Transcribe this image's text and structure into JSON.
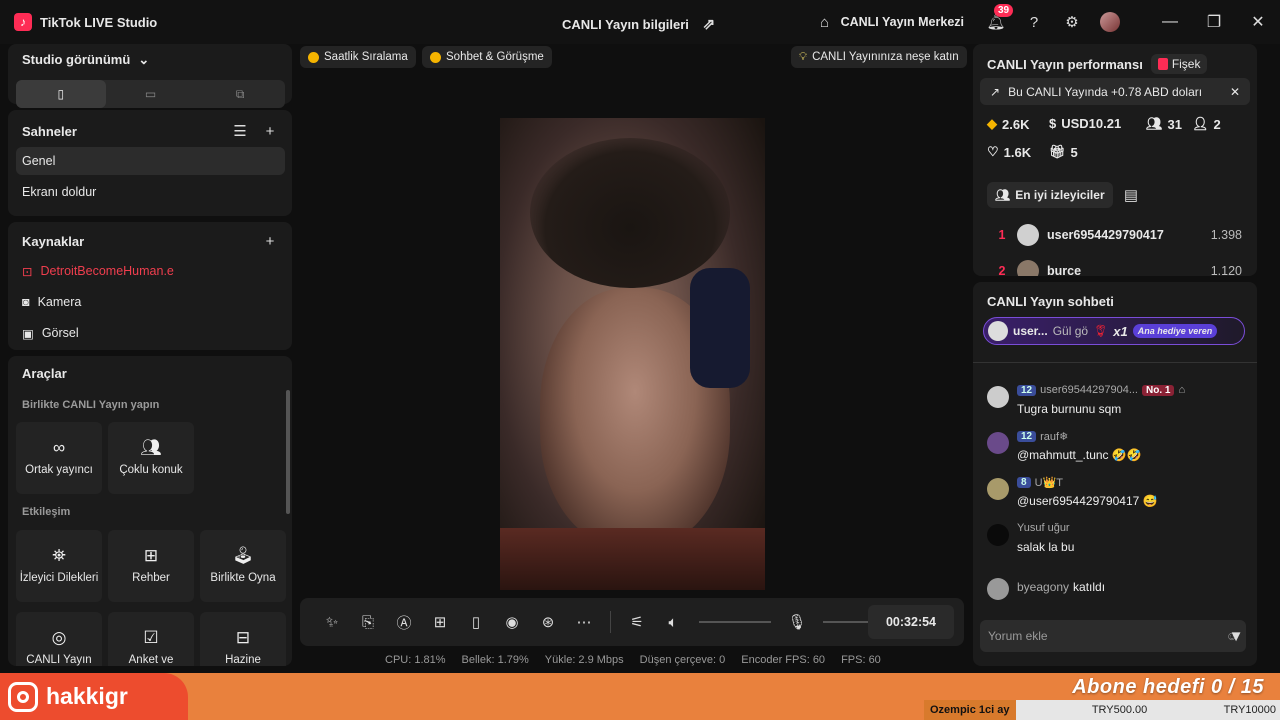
{
  "titlebar": {
    "app_name": "TikTok LIVE Studio",
    "center_title": "CANLI Yayın bilgileri",
    "live_center": "CANLI Yayın Merkezi",
    "notification_count": "39"
  },
  "left": {
    "studio_view": "Studio görünümü",
    "scenes_title": "Sahneler",
    "scenes": [
      "Genel",
      "Ekranı doldur"
    ],
    "sources_title": "Kaynaklar",
    "sources": [
      "DetroitBecomeHuman.e",
      "Kamera",
      "Görsel"
    ],
    "tools_title": "Araçlar",
    "collab_title": "Birlikte CANLI Yayın yapın",
    "collab_tiles": [
      "Ortak yayıncı",
      "Çoklu konuk"
    ],
    "interaction_title": "Etkileşim",
    "interaction_tiles": [
      "İzleyici Dilekleri",
      "Rehber",
      "Birlikte Oyna",
      "CANLI Yayın",
      "Anket ve",
      "Hazine"
    ]
  },
  "center": {
    "chips": [
      "Saatlik Sıralama",
      "Sohbet & Görüşme",
      "CANLI Yayınınıza neşe katın"
    ],
    "timer": "00:32:54",
    "stats": [
      "CPU: 1.81%",
      "Bellek: 1.79%",
      "Yükle: 2.9 Mbps",
      "Düşen çerçeve: 0",
      "Encoder FPS: 60",
      "FPS: 60"
    ]
  },
  "performance": {
    "title": "CANLI Yayın performansı",
    "fisek": "Fişek",
    "notice": "Bu CANLI Yayında +0.78 ABD doları",
    "diamonds": "2.6K",
    "usd": "USD10.21",
    "viewers": "31",
    "new_followers": "2",
    "likes": "1.6K",
    "gifts": "5",
    "top_viewers_tab": "En iyi izleyiciler",
    "ranking": [
      {
        "rank": "1",
        "name": "user6954429790417",
        "score": "1.398"
      },
      {
        "rank": "2",
        "name": "burce",
        "score": "1.120"
      }
    ]
  },
  "chat": {
    "title": "CANLI Yayın sohbeti",
    "gift_user": "user...",
    "gift_text": "Gül gö",
    "gift_count": "x1",
    "gift_tag": "Ana hediye veren",
    "messages": [
      {
        "level": "12",
        "user": "user69544297904...",
        "badge": "No. 1",
        "text": "Tugra burnunu sqm"
      },
      {
        "level": "12",
        "user": "rauf❄",
        "text": "@mahmutt_.tunc 🤣🤣"
      },
      {
        "level": "8",
        "user": "U👑T",
        "text": "@user6954429790417 😅"
      },
      {
        "user": "Yusuf uğur",
        "text": "salak la bu"
      },
      {
        "user": "byeagony",
        "text": "katıldı"
      }
    ],
    "comment_placeholder": "Yorum ekle"
  },
  "overlay": {
    "handle": "hakkigr",
    "goal": "Abone hedefi 0 / 15",
    "ticker_left": "Ozempic 1ci ay",
    "ticker_mid": "TRY500.00",
    "ticker_right": "TRY10000"
  }
}
